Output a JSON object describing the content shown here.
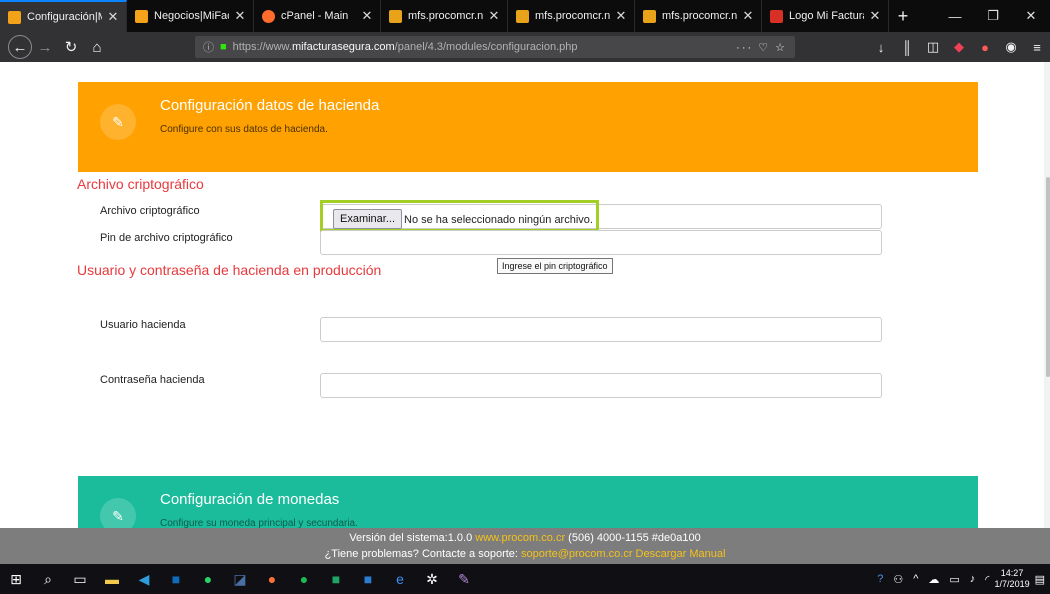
{
  "browser": {
    "tabs": [
      {
        "label": "Configuración|MiFa",
        "favicon_color": "#f4a21a",
        "active": true
      },
      {
        "label": "Negocios|MiFactur",
        "favicon_color": "#f4a21a",
        "active": false
      },
      {
        "label": "cPanel - Main",
        "favicon_color": "#ff6c2c",
        "active": false
      },
      {
        "label": "mfs.procomcr.net /",
        "favicon_color": "#e8a31a",
        "active": false
      },
      {
        "label": "mfs.procomcr.net /",
        "favicon_color": "#e8a31a",
        "active": false
      },
      {
        "label": "mfs.procomcr.net /",
        "favicon_color": "#e8a31a",
        "active": false
      },
      {
        "label": "Logo Mi Factura Se",
        "favicon_color": "#d93025",
        "active": false
      }
    ],
    "url_prefix": "https://www.",
    "url_domain": "mifacturasegura.com",
    "url_path": "/panel/4.3/modules/configuracion.php"
  },
  "hacienda_card": {
    "title": "Configuración datos de hacienda",
    "subtitle": "Configure con sus datos de hacienda."
  },
  "crypto_section": {
    "title": "Archivo criptográfico",
    "file_label": "Archivo criptográfico",
    "file_button": "Examinar...",
    "file_status": "No se ha seleccionado ningún archivo.",
    "pin_label": "Pin de archivo criptográfico",
    "pin_tooltip": "Ingrese el pin criptográfico"
  },
  "production_section": {
    "title": "Usuario y contraseña de hacienda en producción",
    "user_label": "Usuario hacienda",
    "password_label": "Contraseña hacienda"
  },
  "currency_card": {
    "title": "Configuración de monedas",
    "subtitle": "Configure su moneda principal y secundaria."
  },
  "footer": {
    "version_text": "Versión del sistema:1.0.0",
    "site_link": "www.procom.co.cr",
    "phone_text": "(506) 4000-1155 #de0a100",
    "help_text": "¿Tiene problemas? Contacte a soporte:",
    "support_email": "soporte@procom.co.cr",
    "manual_link": "Descargar Manual"
  },
  "taskbar": {
    "time": "14:27",
    "date": "1/7/2019"
  }
}
